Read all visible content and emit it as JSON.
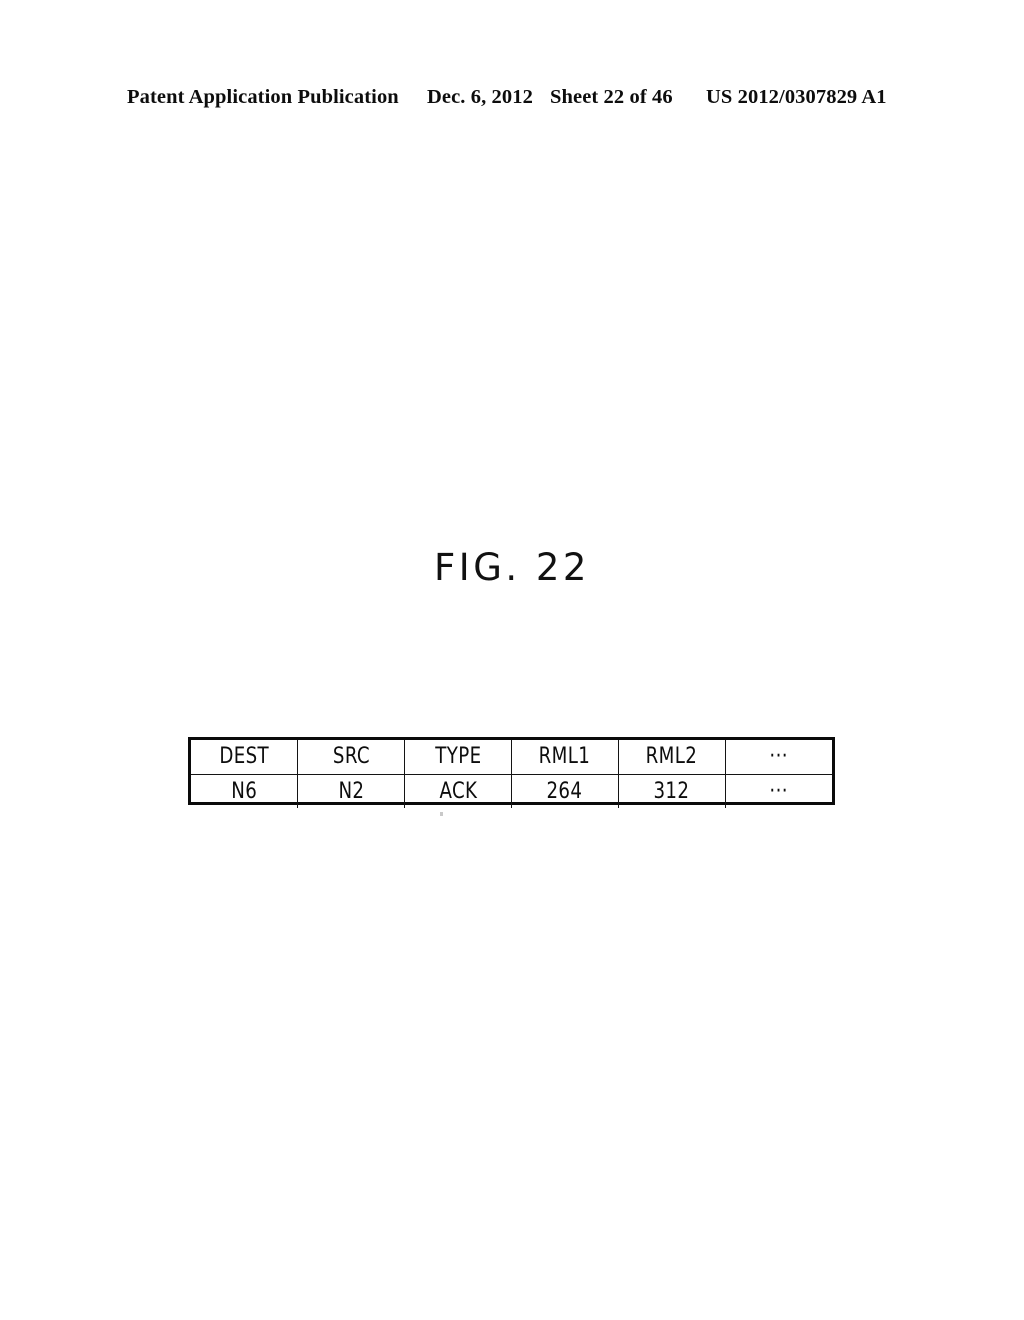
{
  "page": {
    "background": "#ffffff",
    "ink_color": "#0d0d0d"
  },
  "header": {
    "publication": "Patent Application Publication",
    "date": "Dec. 6, 2012",
    "sheet": "Sheet 22 of 46",
    "publication_number": "US 2012/0307829 A1"
  },
  "figure": {
    "title": "FIG. 22",
    "caption": ""
  },
  "packet_table": {
    "columns": [
      "DEST",
      "SRC",
      "TYPE",
      "RML1",
      "RML2",
      "···"
    ],
    "rows": [
      [
        "N6",
        "N2",
        "ACK",
        "264",
        "312",
        "···"
      ]
    ]
  }
}
